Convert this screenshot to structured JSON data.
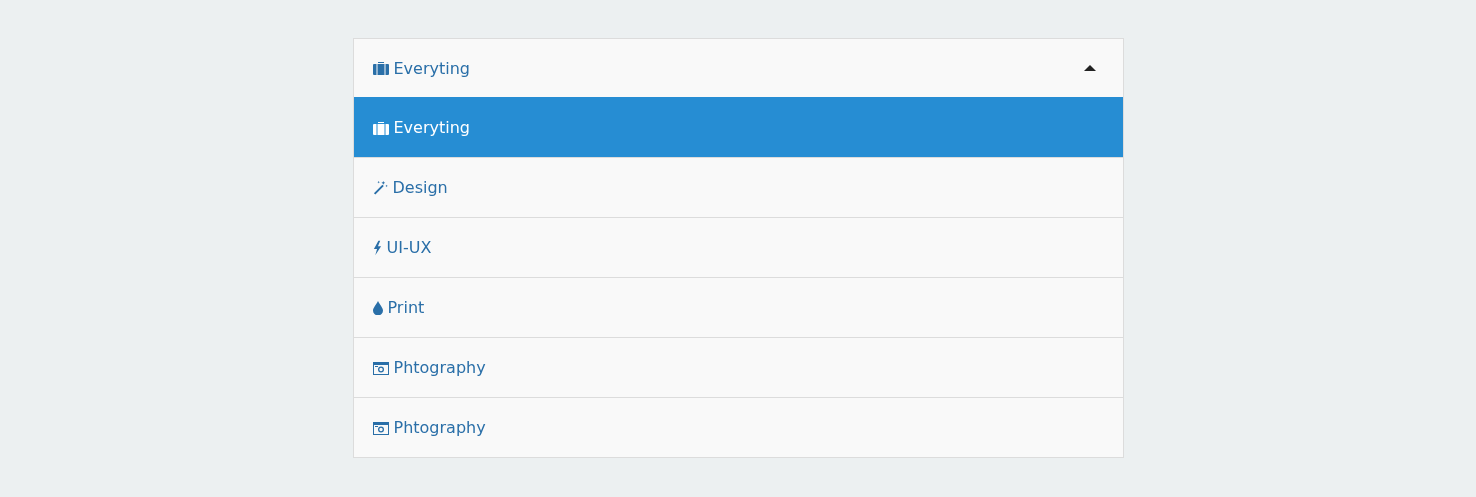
{
  "dropdown": {
    "value": {
      "label": "Everyting",
      "kind": "briefcase"
    },
    "expanded": true,
    "options": [
      {
        "label": "Everyting",
        "kind": "briefcase",
        "selected": true
      },
      {
        "label": "Design",
        "kind": "wand",
        "selected": false
      },
      {
        "label": "UI-UX",
        "kind": "bolt",
        "selected": false
      },
      {
        "label": "Print",
        "kind": "drop",
        "selected": false
      },
      {
        "label": "Phtography",
        "kind": "camera",
        "selected": false
      },
      {
        "label": "Phtography",
        "kind": "camera",
        "selected": false
      }
    ]
  }
}
